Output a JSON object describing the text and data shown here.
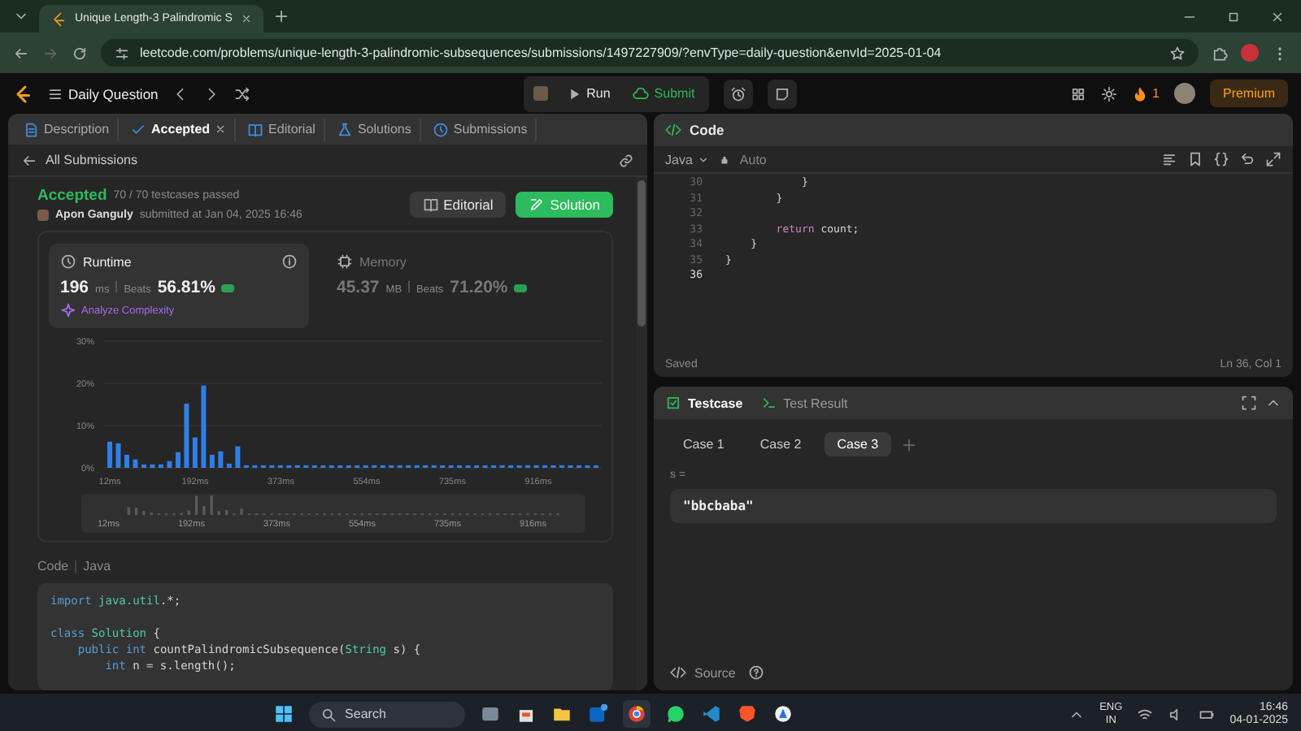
{
  "browser": {
    "tab_title": "Unique Length-3 Palindromic S",
    "url": "leetcode.com/problems/unique-length-3-palindromic-subsequences/submissions/1497227909/?envType=daily-question&envId=2025-01-04"
  },
  "nav": {
    "title": "Daily Question",
    "run": "Run",
    "submit": "Submit",
    "streak": "1",
    "premium": "Premium"
  },
  "left_tabs": [
    {
      "label": "Description",
      "selected": false,
      "closable": false
    },
    {
      "label": "Accepted",
      "selected": true,
      "closable": true
    },
    {
      "label": "Editorial",
      "selected": false,
      "closable": false
    },
    {
      "label": "Solutions",
      "selected": false,
      "closable": false
    },
    {
      "label": "Submissions",
      "selected": false,
      "closable": false
    }
  ],
  "submission": {
    "back": "All Submissions",
    "status": "Accepted",
    "testcases": "70 / 70 testcases passed",
    "user": "Apon Ganguly",
    "submitted": "submitted at Jan 04, 2025 16:46",
    "buttons": [
      "Editorial",
      "Solution"
    ]
  },
  "stats": [
    {
      "label": "Runtime",
      "value": "196",
      "unit": "ms",
      "beats_label": "Beats",
      "beats": "56.81%",
      "selected": true,
      "link": "Analyze Complexity"
    },
    {
      "label": "Memory",
      "value": "45.37",
      "unit": "MB",
      "beats_label": "Beats",
      "beats": "71.20%",
      "selected": false
    }
  ],
  "chart_data": {
    "type": "bar",
    "x": [
      12,
      30,
      48,
      66,
      84,
      102,
      120,
      138,
      156,
      174,
      192,
      210,
      228,
      246,
      264,
      282,
      300,
      318,
      336,
      354,
      372,
      390,
      408,
      426,
      444,
      462,
      480,
      498,
      516,
      534,
      552,
      570,
      588,
      606,
      624,
      642,
      660,
      678,
      696,
      714,
      732,
      750,
      768,
      786,
      804,
      822,
      840,
      858,
      876,
      894,
      912,
      930,
      948,
      966,
      984,
      1002,
      1020,
      1038
    ],
    "values": [
      6.2,
      5.8,
      3.1,
      2.0,
      0.8,
      0.8,
      0.8,
      1.6,
      3.7,
      15.2,
      7.2,
      19.5,
      3.1,
      3.9,
      1.0,
      5.1,
      0.6,
      0.6,
      0.6,
      0.6,
      0.6,
      0.6,
      0.6,
      0.6,
      0.6,
      0.6,
      0.6,
      0.6,
      0.6,
      0.6,
      0.6,
      0.6,
      0.6,
      0.6,
      0.6,
      0.6,
      0.6,
      0.6,
      0.6,
      0.6,
      0.6,
      0.6,
      0.6,
      0.6,
      0.6,
      0.6,
      0.6,
      0.6,
      0.6,
      0.6,
      0.6,
      0.6,
      0.6,
      0.6,
      0.6,
      0.6,
      0.6,
      0.6
    ],
    "xlim": [
      0,
      1050
    ],
    "ylim": [
      0,
      30
    ],
    "xticks": [
      {
        "value": 12,
        "label": "12ms"
      },
      {
        "value": 192,
        "label": "192ms"
      },
      {
        "value": 373,
        "label": "373ms"
      },
      {
        "value": 554,
        "label": "554ms"
      },
      {
        "value": 735,
        "label": "735ms"
      },
      {
        "value": 916,
        "label": "916ms"
      }
    ],
    "yticks": [
      {
        "value": 0,
        "label": "0%"
      },
      {
        "value": 10,
        "label": "10%"
      },
      {
        "value": 20,
        "label": "20%"
      },
      {
        "value": 30,
        "label": "30%"
      }
    ]
  },
  "range_selector": {
    "labels": [
      "12ms",
      "192ms",
      "373ms",
      "554ms",
      "735ms",
      "916ms"
    ]
  },
  "code_header": {
    "label": "Code",
    "language": "Java"
  },
  "submitted_code": [
    {
      "kind": "code",
      "tokens": [
        {
          "t": "import",
          "kind": "kw"
        },
        {
          "t": " java.util",
          "kind": "ty"
        },
        {
          "t": ".*;",
          "kind": "pl"
        }
      ]
    },
    {
      "kind": "blank"
    },
    {
      "kind": "code",
      "tokens": [
        {
          "t": "class",
          "kind": "kw"
        },
        {
          "t": " Solution",
          "kind": "ty"
        },
        {
          "t": " {",
          "kind": "pl"
        }
      ]
    },
    {
      "kind": "code",
      "tokens": [
        {
          "t": "    public int",
          "kind": "kw"
        },
        {
          "t": " countPalindromicSubsequence(",
          "kind": "pl"
        },
        {
          "t": "String",
          "kind": "ty"
        },
        {
          "t": " s) {",
          "kind": "pl"
        }
      ]
    },
    {
      "kind": "code",
      "tokens": [
        {
          "t": "        int",
          "kind": "kw"
        },
        {
          "t": " n = s.length();",
          "kind": "pl"
        }
      ]
    }
  ],
  "editor": {
    "title": "Code",
    "language": "Java",
    "mode": "Auto",
    "status": "Saved",
    "cursor": "Ln 36, Col 1",
    "lines": [
      {
        "number": "30",
        "kind": "code",
        "active": false,
        "tokens": [
          {
            "t": "            }",
            "kind": "pl"
          }
        ]
      },
      {
        "number": "31",
        "kind": "code",
        "active": false,
        "tokens": [
          {
            "t": "        }",
            "kind": "pl"
          }
        ]
      },
      {
        "number": "32",
        "kind": "blank",
        "active": false
      },
      {
        "number": "33",
        "kind": "code",
        "active": false,
        "tokens": [
          {
            "t": "        return",
            "kind": "ctl"
          },
          {
            "t": " count;",
            "kind": "pl"
          }
        ]
      },
      {
        "number": "34",
        "kind": "code",
        "active": false,
        "tokens": [
          {
            "t": "    }",
            "kind": "pl"
          }
        ]
      },
      {
        "number": "35",
        "kind": "code",
        "active": false,
        "tokens": [
          {
            "t": "}",
            "kind": "pl"
          }
        ]
      },
      {
        "number": "36",
        "kind": "blank",
        "active": true
      }
    ]
  },
  "testcase": {
    "tabs": [
      {
        "label": "Testcase",
        "selected": true
      },
      {
        "label": "Test Result",
        "selected": false
      }
    ],
    "cases": [
      {
        "label": "Case 1",
        "selected": false
      },
      {
        "label": "Case 2",
        "selected": false
      },
      {
        "label": "Case 3",
        "selected": true
      }
    ],
    "variable": "s =",
    "value": "\"bbcbaba\"",
    "source": "Source"
  },
  "taskbar": {
    "search": "Search",
    "language": "ENG",
    "region": "IN",
    "time": "16:46",
    "date": "04-01-2025"
  }
}
